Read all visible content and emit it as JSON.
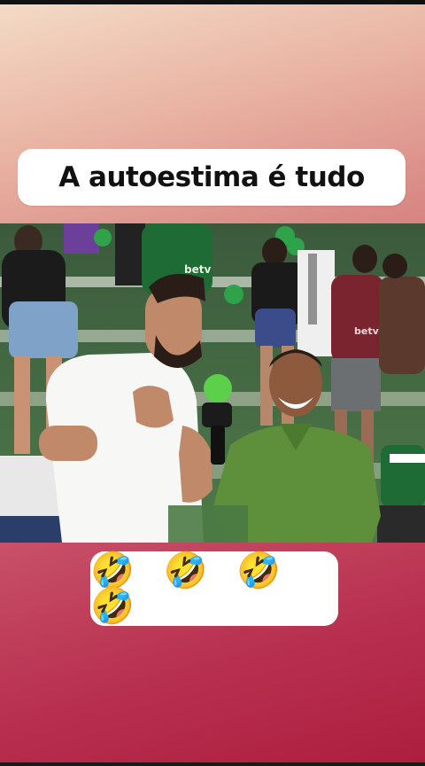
{
  "caption": {
    "text": "A autoestima é tudo"
  },
  "reaction": {
    "emojis": "🤣 🤣 🤣 🤣"
  },
  "video": {
    "jersey_text": "betv",
    "jersey_text_2": "betv"
  }
}
